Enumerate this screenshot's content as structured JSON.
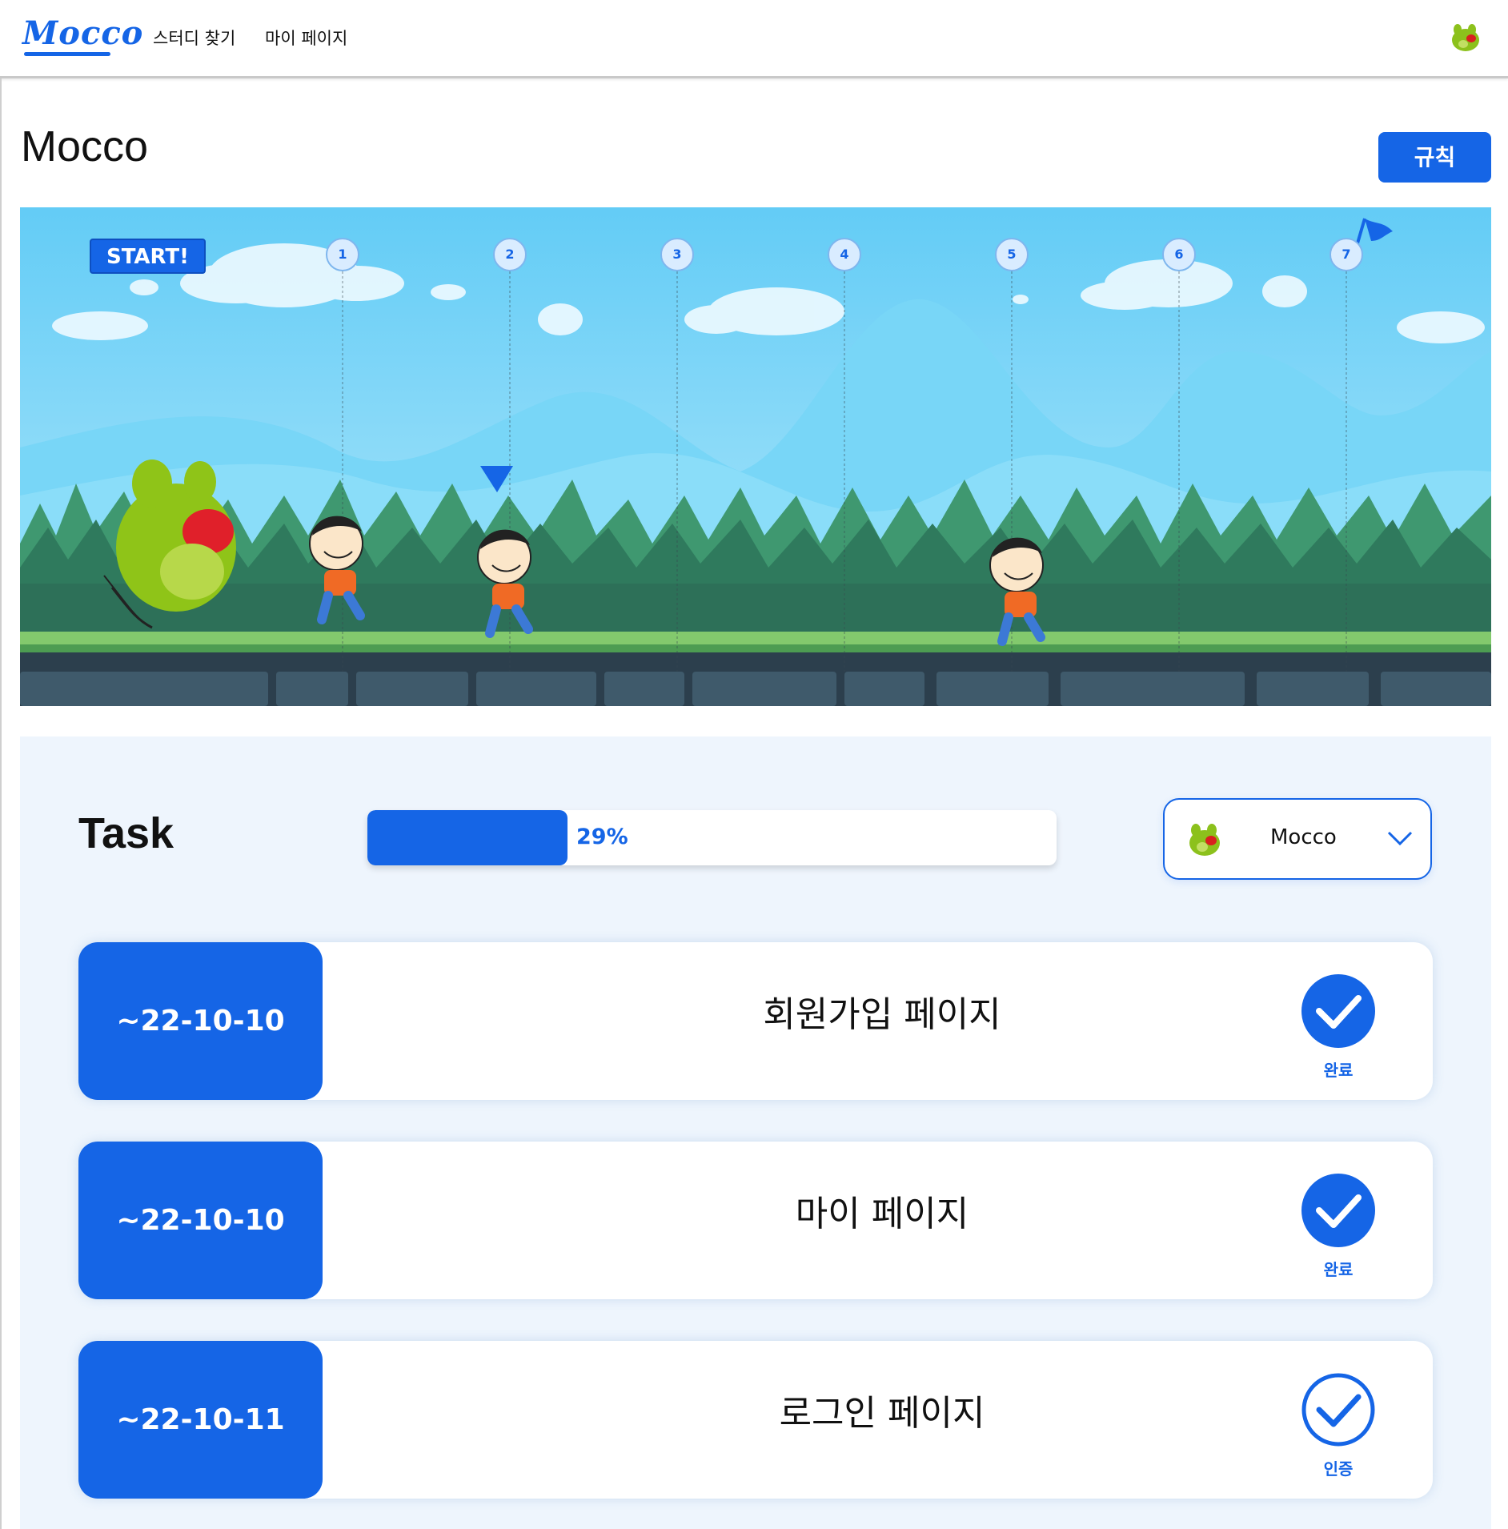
{
  "header": {
    "logo": "Mocco",
    "nav": [
      "스터디 찾기",
      "마이 페이지"
    ],
    "avatar_icon": "frog-avatar-icon"
  },
  "page": {
    "title": "Mocco",
    "rule_button": "규칙"
  },
  "banner": {
    "start_label": "START!",
    "markers": [
      "1",
      "2",
      "3",
      "4",
      "5",
      "6",
      "7"
    ],
    "finish_icon": "flag-icon",
    "colors": {
      "sky": "#7fd3f7",
      "mountain": "#5bc5f1",
      "bush": "#3a8c66",
      "ground": "#7cc46b",
      "stone": "#34505f"
    }
  },
  "task": {
    "title": "Task",
    "progress_percent": 29,
    "progress_label": "29%",
    "member_select": {
      "selected": "Mocco",
      "avatar_icon": "frog-avatar-icon"
    },
    "items": [
      {
        "date": "~22-10-10",
        "name": "회원가입 페이지",
        "status": "완료",
        "done": true
      },
      {
        "date": "~22-10-10",
        "name": "마이 페이지",
        "status": "완료",
        "done": true
      },
      {
        "date": "~22-10-11",
        "name": "로그인 페이지",
        "status": "인증",
        "done": false
      }
    ]
  },
  "colors": {
    "accent": "#1565e6",
    "panel": "#eef5fd"
  }
}
